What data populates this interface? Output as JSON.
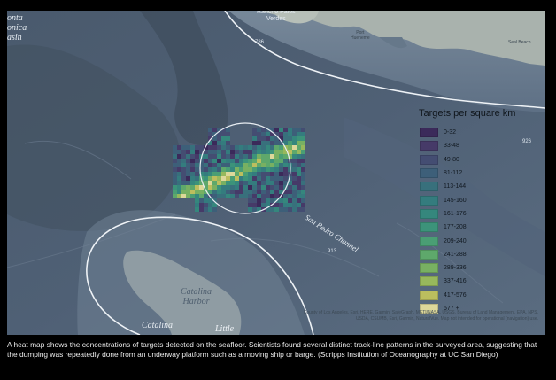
{
  "caption": "A heat map shows the concentrations of targets detected on the seafloor. Scientists found several distinct track-line patterns in the surveyed area, suggesting that the dumping was repeatedly done from an underway platform such as a moving ship or barge. (Scripps Institution of Oceanography at UC San Diego)",
  "map": {
    "place_labels": {
      "santa_monica_basin": "onta\nonica\nasin",
      "san_pedro_channel": "San Pedro Channel",
      "catalina_harbor": "Catalina\nHarbor",
      "catalina": "Catalina",
      "little": "Little",
      "rancho_palos_verdes": "Rancho Palos\nVerdes",
      "port_hueneme": "Port\nHueneme",
      "seal_beach": "Seal Beach"
    },
    "depth_labels": {
      "d786": "786",
      "d926": "926",
      "d913": "913"
    },
    "attribution": "County of Los Angeles, Esri, HERE, Garmin, SafeGraph, METI/NASA, USGS, Bureau of Land Management, EPA, NPS, USDA, CSUMB, Esri, Garmin, NaturalVue. Map not intended for operational (navigation) use."
  },
  "legend": {
    "title": "Targets per square km",
    "items": [
      {
        "label": "0-32",
        "color": "#3b2a5a"
      },
      {
        "label": "33-48",
        "color": "#463a68"
      },
      {
        "label": "49-80",
        "color": "#444d72"
      },
      {
        "label": "81-112",
        "color": "#3d5f79"
      },
      {
        "label": "113-144",
        "color": "#38707c"
      },
      {
        "label": "145-160",
        "color": "#347c7e"
      },
      {
        "label": "161-176",
        "color": "#35877d"
      },
      {
        "label": "177-208",
        "color": "#3c937a"
      },
      {
        "label": "209-240",
        "color": "#4a9e74"
      },
      {
        "label": "241-288",
        "color": "#5ea86b"
      },
      {
        "label": "289-336",
        "color": "#78b062"
      },
      {
        "label": "337-416",
        "color": "#97b85c"
      },
      {
        "label": "417-576",
        "color": "#bcbe5e"
      },
      {
        "label": "577 +",
        "color": "#ddd89a"
      }
    ]
  }
}
